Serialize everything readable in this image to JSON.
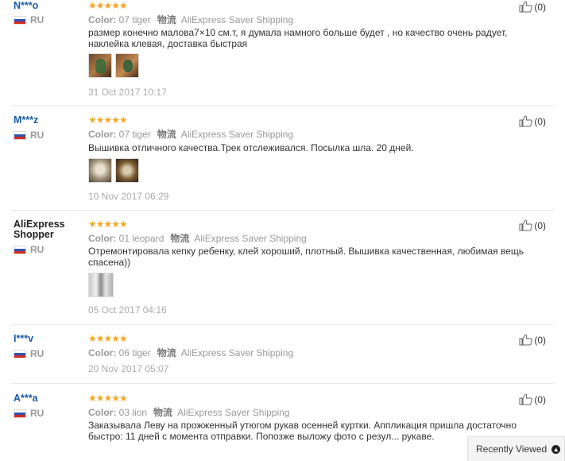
{
  "reviews": [
    {
      "user": "N***o",
      "country": "RU",
      "rating": "★★★★★",
      "color_label": "Color:",
      "color_value": "07 tiger",
      "shipping_icon": "物流",
      "shipping": "AliExpress Saver Shipping",
      "text": "размер конечно малова7×10 см.т, я думала намного больше будет , но качество очень радует, наклейка клевая, доставка быстрая",
      "date": "31 Oct 2017 10:17",
      "helpful": "(0)"
    },
    {
      "user": "M***z",
      "country": "RU",
      "rating": "★★★★★",
      "color_label": "Color:",
      "color_value": "07 tiger",
      "shipping_icon": "物流",
      "shipping": "AliExpress Saver Shipping",
      "text": "Вышивка отличного качества.Трек отслеживался. Посылка шла. 20 дней.",
      "date": "10 Nov 2017 06:29",
      "helpful": "(0)"
    },
    {
      "user": "AliExpress Shopper",
      "country": "RU",
      "rating": "★★★★★",
      "color_label": "Color:",
      "color_value": "01 leopard",
      "shipping_icon": "物流",
      "shipping": "AliExpress Saver Shipping",
      "text": "Отремонтировала кепку ребенку, клей хороший, плотный. Вышивка качественная, любимая вещь спасена))",
      "date": "05 Oct 2017 04:16",
      "helpful": "(0)"
    },
    {
      "user": "I***v",
      "country": "RU",
      "rating": "★★★★★",
      "color_label": "Color:",
      "color_value": "06 tiger",
      "shipping_icon": "物流",
      "shipping": "AliExpress Saver Shipping",
      "text": "",
      "date": "20 Nov 2017 05:07",
      "helpful": "(0)"
    },
    {
      "user": "A***a",
      "country": "RU",
      "rating": "★★★★★",
      "color_label": "Color:",
      "color_value": "03 lion",
      "shipping_icon": "物流",
      "shipping": "AliExpress Saver Shipping",
      "text": "Заказывала Леву на прожженный утюгом рукав осенней куртки. Аппликация пришла достаточно быстро: 11 дней с момента отправки. Попозже выложу фото с резул... рукаве.",
      "date": "",
      "helpful": "(0)"
    }
  ],
  "recently_viewed": {
    "label": "Recently Viewed"
  }
}
